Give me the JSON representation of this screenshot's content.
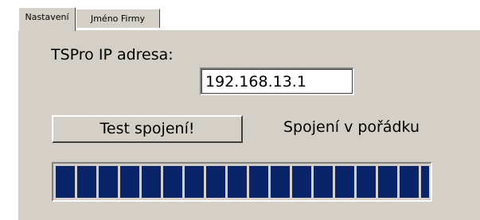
{
  "tabs": [
    {
      "label": "Nastavení",
      "active": true
    },
    {
      "label": "Jméno Firmy",
      "active": false
    }
  ],
  "connection": {
    "ip_label": "TSPro IP adresa:",
    "ip_value": "192.168.13.1",
    "test_button_label": "Test spojení!",
    "status_text": "Spojení v pořádku"
  },
  "progress": {
    "fraction": 1.0,
    "block_count": 18
  },
  "colors": {
    "window_bg": "#d4d0c8",
    "progress_block": "#0a246a"
  }
}
